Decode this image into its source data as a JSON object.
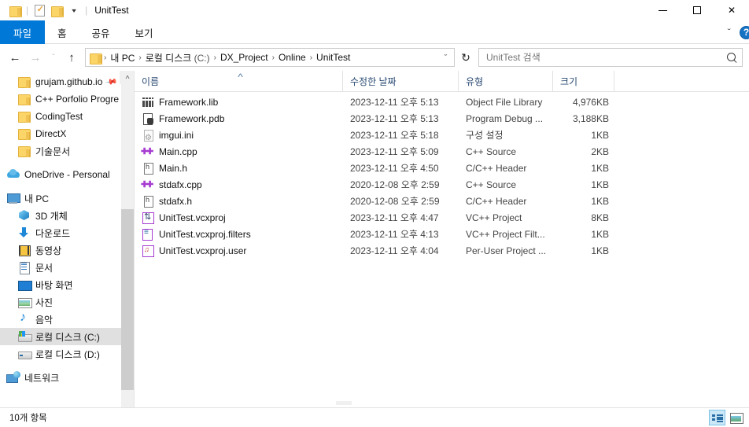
{
  "window": {
    "title": "UnitTest",
    "quick_access": [
      {
        "name": "folder-icon",
        "label": ""
      },
      {
        "name": "properties-icon",
        "label": ""
      },
      {
        "name": "new-folder-icon",
        "label": ""
      }
    ],
    "controls": {
      "minimize": "—",
      "maximize": "☐",
      "close": "✕"
    }
  },
  "ribbon": {
    "tabs": [
      {
        "label": "파일",
        "active": true
      },
      {
        "label": "홈",
        "active": false
      },
      {
        "label": "공유",
        "active": false
      },
      {
        "label": "보기",
        "active": false
      }
    ],
    "expand_caret": "ˇ",
    "help_label": "?",
    "accent_color": "#0078D7"
  },
  "navigation": {
    "back": "←",
    "forward": "→",
    "recent_caret": "ˇ",
    "up": "↑",
    "refresh": "↻",
    "crumb_caret": "ˇ"
  },
  "breadcrumb": {
    "separator": "›",
    "items": [
      {
        "label": "내 PC",
        "suffix": ""
      },
      {
        "label": "로컬 디스크",
        "suffix": " (C:)"
      },
      {
        "label": "DX_Project",
        "suffix": ""
      },
      {
        "label": "Online",
        "suffix": ""
      },
      {
        "label": "UnitTest",
        "suffix": ""
      }
    ]
  },
  "search": {
    "placeholder": "UnitTest 검색",
    "value": ""
  },
  "sidebar": {
    "items": [
      {
        "label": "grujam.github.io",
        "icon": "folder-icon",
        "indent": 1,
        "pinned": true,
        "selected": false,
        "gap_before": false
      },
      {
        "label": "C++ Porfolio Progre",
        "icon": "folder-icon",
        "indent": 1,
        "pinned": false,
        "selected": false,
        "gap_before": false
      },
      {
        "label": "CodingTest",
        "icon": "folder-icon",
        "indent": 1,
        "pinned": false,
        "selected": false,
        "gap_before": false
      },
      {
        "label": "DirectX",
        "icon": "folder-icon",
        "indent": 1,
        "pinned": false,
        "selected": false,
        "gap_before": false
      },
      {
        "label": "기술문서",
        "icon": "folder-icon",
        "indent": 1,
        "pinned": false,
        "selected": false,
        "gap_before": false
      },
      {
        "label": "OneDrive - Personal",
        "icon": "cloud-icon",
        "indent": 0,
        "pinned": false,
        "selected": false,
        "gap_before": true
      },
      {
        "label": "내 PC",
        "icon": "pc-icon",
        "indent": 0,
        "pinned": false,
        "selected": false,
        "gap_before": true
      },
      {
        "label": "3D 개체",
        "icon": "3d-object-icon",
        "indent": 1,
        "pinned": false,
        "selected": false,
        "gap_before": false
      },
      {
        "label": "다운로드",
        "icon": "download-icon",
        "indent": 1,
        "pinned": false,
        "selected": false,
        "gap_before": false
      },
      {
        "label": "동영상",
        "icon": "video-icon",
        "indent": 1,
        "pinned": false,
        "selected": false,
        "gap_before": false
      },
      {
        "label": "문서",
        "icon": "document-icon",
        "indent": 1,
        "pinned": false,
        "selected": false,
        "gap_before": false
      },
      {
        "label": "바탕 화면",
        "icon": "desktop-icon",
        "indent": 1,
        "pinned": false,
        "selected": false,
        "gap_before": false
      },
      {
        "label": "사진",
        "icon": "picture-icon",
        "indent": 1,
        "pinned": false,
        "selected": false,
        "gap_before": false
      },
      {
        "label": "음악",
        "icon": "music-icon",
        "indent": 1,
        "pinned": false,
        "selected": false,
        "gap_before": false
      },
      {
        "label": "로컬 디스크 (C:)",
        "icon": "drive-windows-icon",
        "indent": 1,
        "pinned": false,
        "selected": true,
        "gap_before": false
      },
      {
        "label": "로컬 디스크 (D:)",
        "icon": "drive-icon",
        "indent": 1,
        "pinned": false,
        "selected": false,
        "gap_before": false
      },
      {
        "label": "네트워크",
        "icon": "network-icon",
        "indent": 0,
        "pinned": false,
        "selected": false,
        "gap_before": true
      }
    ],
    "scroll_up": "˄",
    "scroll_down": "˅"
  },
  "file_list": {
    "columns": [
      {
        "label": "이름",
        "sorted": "asc"
      },
      {
        "label": "수정한 날짜",
        "sorted": ""
      },
      {
        "label": "유형",
        "sorted": ""
      },
      {
        "label": "크기",
        "sorted": ""
      }
    ],
    "sort_arrow": "˄",
    "rows": [
      {
        "name": "Framework.lib",
        "icon": "library-file-icon",
        "date": "2023-12-11 오후 5:13",
        "type": "Object File Library",
        "size": "4,976KB"
      },
      {
        "name": "Framework.pdb",
        "icon": "pdb-file-icon",
        "date": "2023-12-11 오후 5:13",
        "type": "Program Debug ...",
        "size": "3,188KB"
      },
      {
        "name": "imgui.ini",
        "icon": "ini-file-icon",
        "date": "2023-12-11 오후 5:18",
        "type": "구성 설정",
        "size": "1KB"
      },
      {
        "name": "Main.cpp",
        "icon": "cpp-source-icon",
        "date": "2023-12-11 오후 5:09",
        "type": "C++ Source",
        "size": "2KB"
      },
      {
        "name": "Main.h",
        "icon": "header-file-icon",
        "date": "2023-12-11 오후 4:50",
        "type": "C/C++ Header",
        "size": "1KB"
      },
      {
        "name": "stdafx.cpp",
        "icon": "cpp-source-icon",
        "date": "2020-12-08 오후 2:59",
        "type": "C++ Source",
        "size": "1KB"
      },
      {
        "name": "stdafx.h",
        "icon": "header-file-icon",
        "date": "2020-12-08 오후 2:59",
        "type": "C/C++ Header",
        "size": "1KB"
      },
      {
        "name": "UnitTest.vcxproj",
        "icon": "vcxproj-file-icon",
        "date": "2023-12-11 오후 4:47",
        "type": "VC++ Project",
        "size": "8KB"
      },
      {
        "name": "UnitTest.vcxproj.filters",
        "icon": "vcxproj-filters-icon",
        "date": "2023-12-11 오후 4:13",
        "type": "VC++ Project Filt...",
        "size": "1KB"
      },
      {
        "name": "UnitTest.vcxproj.user",
        "icon": "vcxproj-user-icon",
        "date": "2023-12-11 오후 4:04",
        "type": "Per-User Project ...",
        "size": "1KB"
      }
    ]
  },
  "statusbar": {
    "item_count": "10개 항목",
    "views": [
      {
        "name": "details-view",
        "active": true
      },
      {
        "name": "large-icons-view",
        "active": false
      }
    ]
  }
}
